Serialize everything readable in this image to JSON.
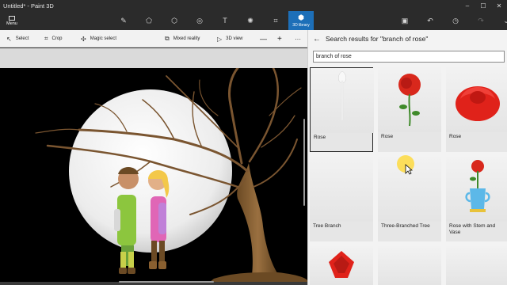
{
  "titlebar": {
    "title": "Untitled* - Paint 3D"
  },
  "ribbon": {
    "menu_label": "Menu",
    "active_tool_label": "3D library"
  },
  "subbar": {
    "select": "Select",
    "crop": "Crop",
    "magic_select": "Magic select",
    "mixed_reality": "Mixed reality",
    "view_3d": "3D view",
    "zoom_out": "—",
    "zoom_in": "+",
    "more": "···"
  },
  "panel": {
    "header": "Search results for \"branch of rose\"",
    "search_value": "branch of rose",
    "results": [
      {
        "label": "Rose",
        "selected": true
      },
      {
        "label": "Rose",
        "selected": false
      },
      {
        "label": "Rose",
        "selected": false
      },
      {
        "label": "Tree Branch",
        "selected": false
      },
      {
        "label": "Three-Branched Tree",
        "selected": false
      },
      {
        "label": "Rose with Stem and Vase",
        "selected": false
      },
      {
        "label": "",
        "selected": false
      },
      {
        "label": "",
        "selected": false
      },
      {
        "label": "",
        "selected": false
      }
    ]
  },
  "colors": {
    "accent": "#1d6fb8",
    "titlebar": "#2b2b2b",
    "panel": "#f3f3f3",
    "canvas_sky": "#000000",
    "moon": "#e8e8e8"
  }
}
